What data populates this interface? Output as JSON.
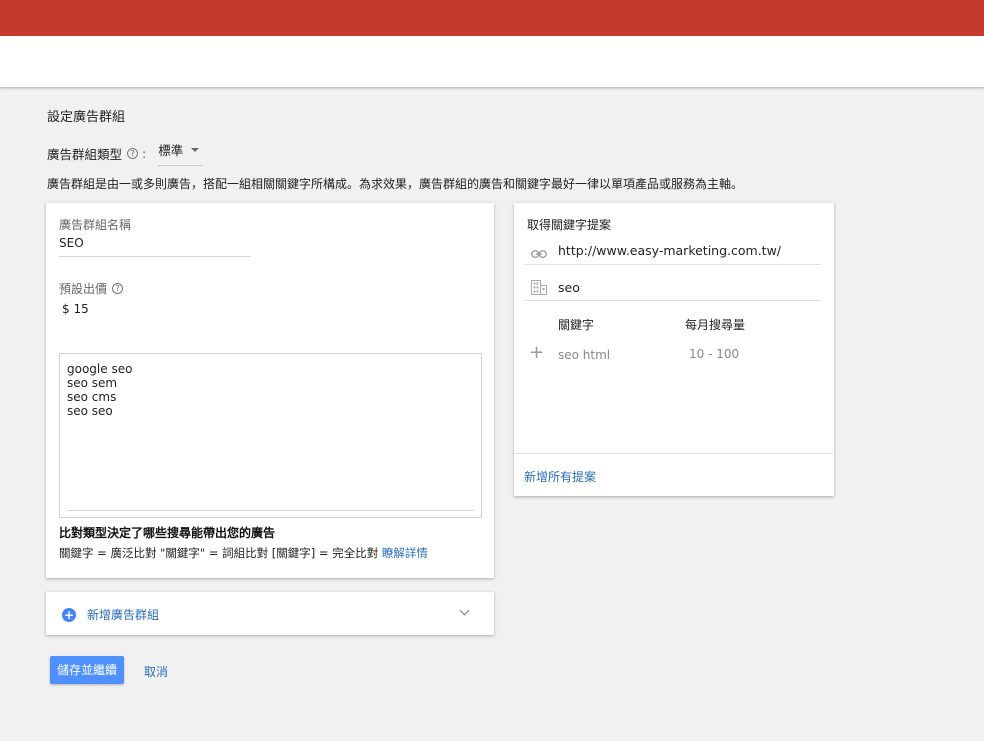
{
  "page": {
    "title": "設定廣告群組",
    "group_type_label": "廣告群組類型",
    "group_type_help": "?",
    "group_type_colon": ":",
    "group_type_value": "標準",
    "description": "廣告群組是由一或多則廣告，搭配一組相關關鍵字所構成。為求效果，廣告群組的廣告和關鍵字最好一律以單項產品或服務為主軸。"
  },
  "ad_group": {
    "name_label": "廣告群組名稱",
    "name_value": "SEO",
    "bid_label": "預設出價",
    "bid_help": "?",
    "bid_value": "$ 15",
    "keywords": [
      "google seo",
      "seo sem",
      "seo cms",
      "seo seo"
    ],
    "match_heading": "比對類型決定了哪些搜尋能帶出您的廣告",
    "match_text": "關鍵字 = 廣泛比對 \"關鍵字\" = 詞組比對 [關鍵字] = 完全比對",
    "match_link": "瞭解詳情"
  },
  "add_group": {
    "label": "新增廣告群組"
  },
  "suggestions": {
    "title": "取得關鍵字提案",
    "url": "http://www.easy-marketing.com.tw/",
    "product": "seo",
    "col_keyword": "關鍵字",
    "col_volume": "每月搜尋量",
    "rows": [
      {
        "keyword": "seo html",
        "volume": "10 - 100"
      }
    ],
    "add_all": "新增所有提案"
  },
  "actions": {
    "save": "儲存並繼續",
    "cancel": "取消"
  },
  "colors": {
    "topbar": "#c5392b",
    "primary_button": "#4d90fe",
    "link": "#2a6ebb"
  }
}
